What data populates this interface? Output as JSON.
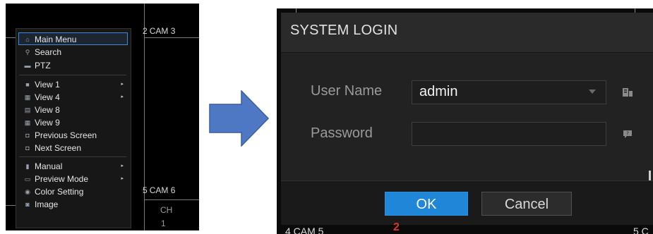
{
  "dvr_view": {
    "cam_top_right": {
      "num": "2",
      "label": "CAM 3"
    },
    "cam_bottom_right": {
      "num": "5",
      "label": "CAM 6"
    },
    "ch_label": "CH",
    "ch_num": "1"
  },
  "context_menu": {
    "items": [
      {
        "label": "Main Menu",
        "icon": "home-icon",
        "selected": true
      },
      {
        "label": "Search",
        "icon": "search-icon"
      },
      {
        "label": "PTZ",
        "icon": "ptz-icon"
      },
      {
        "label": "View 1",
        "icon": "view1-icon",
        "submenu": true
      },
      {
        "label": "View 4",
        "icon": "view4-icon",
        "submenu": true
      },
      {
        "label": "View 8",
        "icon": "view8-icon"
      },
      {
        "label": "View 9",
        "icon": "view9-icon"
      },
      {
        "label": "Previous Screen",
        "icon": "previous-screen-icon"
      },
      {
        "label": "Next Screen",
        "icon": "next-screen-icon"
      },
      {
        "label": "Manual",
        "icon": "manual-icon",
        "submenu": true
      },
      {
        "label": "Preview Mode",
        "icon": "preview-mode-icon",
        "submenu": true
      },
      {
        "label": "Color Setting",
        "icon": "color-setting-icon"
      },
      {
        "label": "Image",
        "icon": "image-icon"
      }
    ],
    "submenu_arrow": "▸"
  },
  "login_dialog": {
    "title": "SYSTEM LOGIN",
    "username_label": "User Name",
    "username_value": "admin",
    "password_label": "Password",
    "password_value": "",
    "ok_label": "OK",
    "cancel_label": "Cancel",
    "accent_color": "#1f86d8"
  },
  "background_labels": {
    "bottom_left": "4 CAM 5",
    "bottom_right": "5 C",
    "red_mark": "2"
  }
}
